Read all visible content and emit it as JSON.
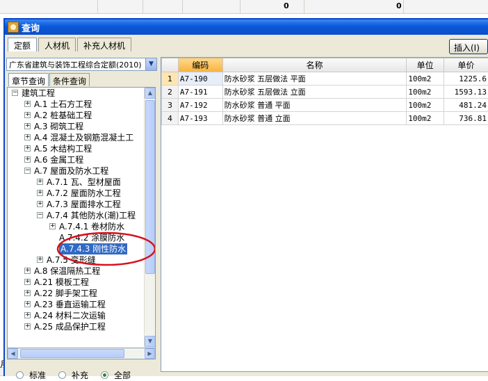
{
  "background": {
    "top_values": [
      "0",
      "0"
    ],
    "top_right_text": "...",
    "bottom_left_text": "月"
  },
  "dialog": {
    "title": "查询",
    "tabs": [
      "定额",
      "人材机",
      "补充人材机"
    ],
    "insert_button": "插入(I)"
  },
  "left": {
    "combo_value": "广东省建筑与装饰工程综合定额(2010)",
    "subtabs": [
      "章节查询",
      "条件查询"
    ],
    "tree": [
      {
        "label": "建筑工程",
        "level": 0,
        "expander": "minus"
      },
      {
        "label": "A.1 土石方工程",
        "level": 1,
        "expander": "plus"
      },
      {
        "label": "A.2 桩基础工程",
        "level": 1,
        "expander": "plus"
      },
      {
        "label": "A.3 砌筑工程",
        "level": 1,
        "expander": "plus"
      },
      {
        "label": "A.4 混凝土及钢筋混凝土工",
        "level": 1,
        "expander": "plus"
      },
      {
        "label": "A.5 木结构工程",
        "level": 1,
        "expander": "plus"
      },
      {
        "label": "A.6 金属工程",
        "level": 1,
        "expander": "plus"
      },
      {
        "label": "A.7 屋面及防水工程",
        "level": 1,
        "expander": "minus"
      },
      {
        "label": "A.7.1 瓦、型材屋面",
        "level": 2,
        "expander": "plus"
      },
      {
        "label": "A.7.2 屋面防水工程",
        "level": 2,
        "expander": "plus"
      },
      {
        "label": "A.7.3 屋面排水工程",
        "level": 2,
        "expander": "plus"
      },
      {
        "label": "A.7.4 其他防水(潮)工程",
        "level": 2,
        "expander": "minus"
      },
      {
        "label": "A.7.4.1 卷材防水",
        "level": 3,
        "expander": "plus"
      },
      {
        "label": "A.7.4.2 涂膜防水",
        "level": 3,
        "expander": "none"
      },
      {
        "label": "A.7.4.3 刚性防水",
        "level": 3,
        "expander": "none",
        "selected": true
      },
      {
        "label": "A.7.5 变形缝",
        "level": 2,
        "expander": "plus"
      },
      {
        "label": "A.8 保温隔热工程",
        "level": 1,
        "expander": "plus"
      },
      {
        "label": "A.21 模板工程",
        "level": 1,
        "expander": "plus"
      },
      {
        "label": "A.22 脚手架工程",
        "level": 1,
        "expander": "plus"
      },
      {
        "label": "A.23 垂直运输工程",
        "level": 1,
        "expander": "plus"
      },
      {
        "label": "A.24 材料二次运输",
        "level": 1,
        "expander": "plus"
      },
      {
        "label": "A.25 成品保护工程",
        "level": 1,
        "expander": "plus"
      }
    ],
    "radios": [
      {
        "label": "标准",
        "checked": false
      },
      {
        "label": "补充",
        "checked": false
      },
      {
        "label": "全部",
        "checked": true
      }
    ]
  },
  "grid": {
    "headers": [
      "编码",
      "名称",
      "单位",
      "单价"
    ],
    "rows": [
      {
        "num": "1",
        "code": "A7-190",
        "name": "防水砂浆 五层做法 平面",
        "unit": "100m2",
        "price": "1225.6"
      },
      {
        "num": "2",
        "code": "A7-191",
        "name": "防水砂浆 五层做法 立面",
        "unit": "100m2",
        "price": "1593.13"
      },
      {
        "num": "3",
        "code": "A7-192",
        "name": "防水砂浆 普通 平面",
        "unit": "100m2",
        "price": "481.24"
      },
      {
        "num": "4",
        "code": "A7-193",
        "name": "防水砂浆 普通 立面",
        "unit": "100m2",
        "price": "736.81"
      }
    ]
  },
  "colors": {
    "title_bar": "#0a58d8",
    "selection": "#316ac5",
    "highlight_circle": "#d8101a",
    "header_highlight": "#f7b33e"
  }
}
